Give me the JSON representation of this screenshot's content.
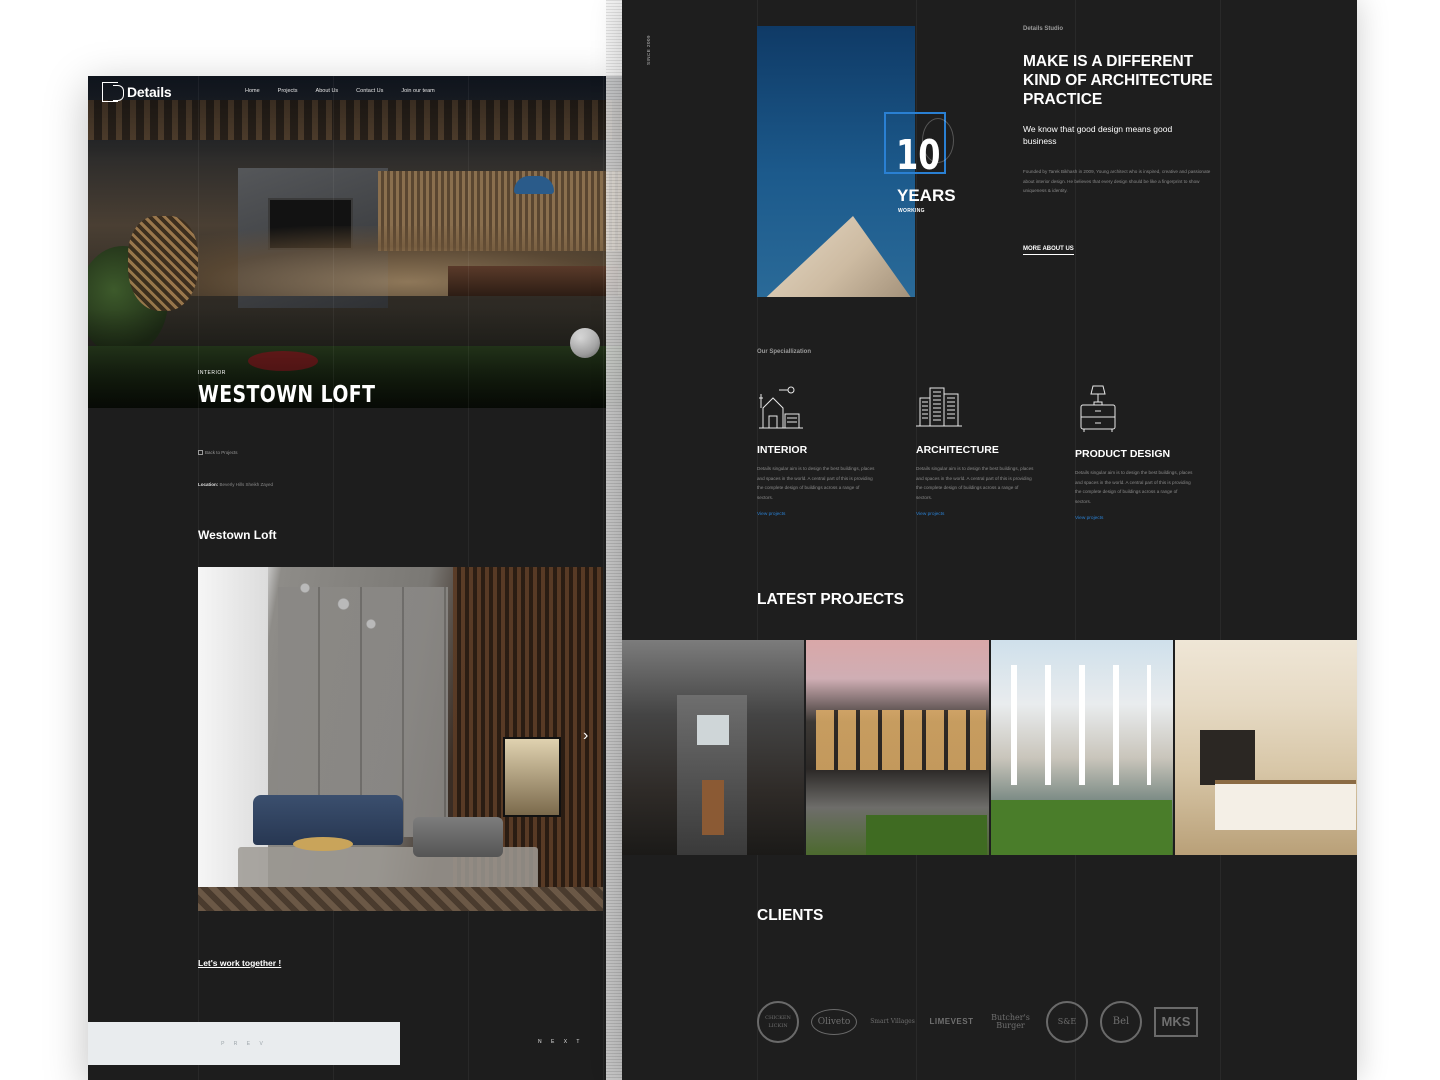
{
  "left_page": {
    "logo_text": "Details",
    "nav": [
      "Home",
      "Projects",
      "About Us",
      "Contact Us",
      "Join our team"
    ],
    "hero": {
      "category": "INTERIOR",
      "title": "WESTOWN LOFT"
    },
    "back_link": "Back to Projects",
    "location_label": "Location:",
    "location_value": "Beverly Hills Sheikh Zayed",
    "project_heading": "Westown Loft",
    "cta": "Let's work together !",
    "prev_label": "P R E V",
    "next_label": "N E X T"
  },
  "right_page": {
    "since": "SINCE 2009",
    "years": {
      "number": "10",
      "label": "YEARS",
      "sub": "WORKING"
    },
    "studio": {
      "kicker": "Details Studio",
      "title": "MAKE IS A DIFFERENT KIND OF ARCHITECTURE PRACTICE",
      "lead": "We know that good design means good business",
      "body": "Founded by Tarek Bikhash in 2009, Young architect who is inspired, creative and passionate about interior design. He believes that every design should be like a fingerprint to show uniqueness & identity.",
      "more_link": "MORE ABOUT US"
    },
    "specialization": {
      "kicker": "Our Speciallization",
      "items": [
        {
          "icon": "house-icon",
          "title": "INTERIOR",
          "body": "Details singular aim is to design the best buildings, places and spaces in the world. A central part of this is providing the complete design of buildings across a range of sectors.",
          "link": "View projects"
        },
        {
          "icon": "buildings-icon",
          "title": "ARCHITECTURE",
          "body": "Details singular aim is to design the best buildings, places and spaces in the world. A central part of this is providing the complete design of buildings across a range of sectors.",
          "link": "View projects"
        },
        {
          "icon": "lamp-drawer-icon",
          "title": "PRODUCT DESIGN",
          "body": "Details singular aim is to design the best buildings, places and spaces in the world. A central part of this is providing the complete design of buildings across a range of sectors.",
          "link": "View projects"
        }
      ]
    },
    "latest_projects_title": "LATEST PROJECTS",
    "clients_title": "CLIENTS",
    "clients": [
      "CHICKEN LICKIN",
      "Oliveto",
      "Smart Villages",
      "LIMEVEST",
      "Butcher's Burger",
      "S&E",
      "Bel",
      "MKS"
    ],
    "accent_color": "#2a80d3"
  }
}
